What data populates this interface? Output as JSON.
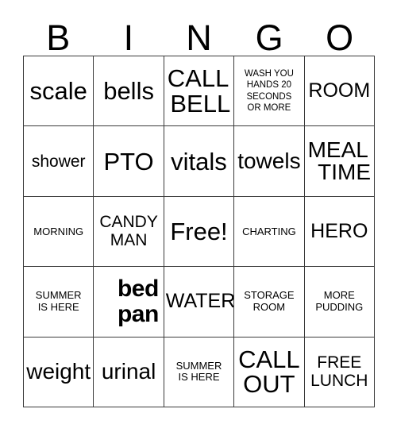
{
  "card": {
    "title": "BINGO",
    "header_letters": [
      "B",
      "I",
      "N",
      "G",
      "O"
    ],
    "border_color": "#3a3a3a",
    "background_color": "#ffffff",
    "text_color": "#000000",
    "rows": [
      [
        {
          "text": "scale"
        },
        {
          "text": "bells"
        },
        {
          "lines": [
            "CALL",
            "BELL"
          ]
        },
        {
          "lines": [
            "WASH YOU",
            "HANDS 20",
            "SECONDS",
            "OR MORE"
          ]
        },
        {
          "text": "ROOM"
        }
      ],
      [
        {
          "text": "shower"
        },
        {
          "text": "PTO"
        },
        {
          "text": "vitals"
        },
        {
          "text": "towels"
        },
        {
          "lines": [
            "MEAL",
            "TIME"
          ]
        }
      ],
      [
        {
          "text": "MORNING"
        },
        {
          "lines": [
            "CANDY",
            "MAN"
          ]
        },
        {
          "text": "Free!"
        },
        {
          "text": "CHARTING"
        },
        {
          "text": "HERO"
        }
      ],
      [
        {
          "lines": [
            "SUMMER",
            "IS HERE"
          ]
        },
        {
          "lines": [
            "bed",
            "pan"
          ]
        },
        {
          "text": "WATER"
        },
        {
          "lines": [
            "STORAGE",
            "ROOM"
          ]
        },
        {
          "lines": [
            "MORE",
            "PUDDING"
          ]
        }
      ],
      [
        {
          "text": "weight"
        },
        {
          "text": "urinal"
        },
        {
          "lines": [
            "SUMMER",
            "IS HERE"
          ]
        },
        {
          "lines": [
            "CALL",
            "OUT"
          ]
        },
        {
          "lines": [
            "FREE",
            "LUNCH"
          ]
        }
      ]
    ],
    "free_space": {
      "row": 2,
      "column": 2,
      "label": "Free!"
    }
  }
}
